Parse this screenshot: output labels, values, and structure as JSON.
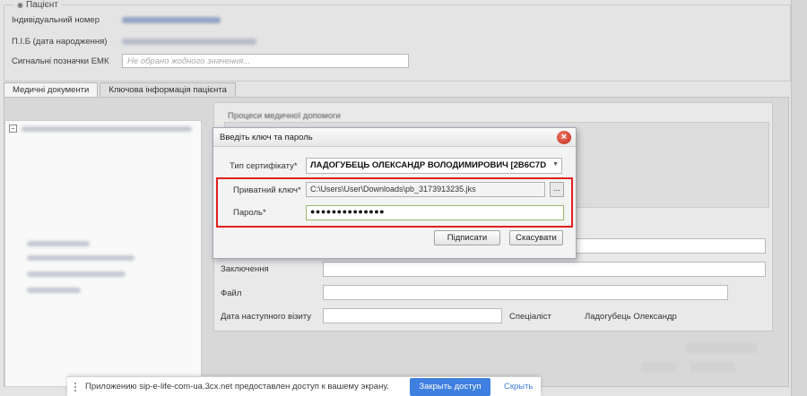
{
  "patient": {
    "legend": "Пацієнт",
    "fields": {
      "individual_number_label": "Індивідуальний номер",
      "full_name_label": "П.І.Б (дата народження)",
      "signal_marks_label": "Сигнальні позначки ЕМК",
      "signal_marks_placeholder": "Не обрано жодного значення..."
    }
  },
  "tabs": [
    {
      "label": "Медичні документи",
      "active": true
    },
    {
      "label": "Ключова інформація пацієнта",
      "active": false
    }
  ],
  "main": {
    "processes_label": "Процеси медичної допомоги",
    "conclusion_label": "Заключення",
    "file_label": "Файл",
    "next_visit_label": "Дата наступного візиту",
    "specialist_label": "Спеціаліст",
    "specialist_value": "Ладогубець Олександр"
  },
  "dialog": {
    "title": "Введіть ключ та пароль",
    "cert_type_label": "Тип сертифікату*",
    "cert_type_value": "ЛАДОГУБЕЦЬ ОЛЕКСАНДР ВОЛОДИМИРОВИЧ [2B6C7D",
    "private_key_label": "Приватний ключ*",
    "private_key_value": "C:\\Users\\User\\Downloads\\pb_3173913235.jks",
    "browse_label": "...",
    "password_label": "Пароль*",
    "password_value": "●●●●●●●●●●●●●●",
    "sign_button": "Підписати",
    "cancel_button": "Скасувати",
    "highlight_color": "#e02020"
  },
  "notification": {
    "text": "Приложению sip-e-life-com-ua.3cx.net предоставлен доступ к вашему экрану.",
    "stop_button": "Закрыть доступ",
    "hide_link": "Скрыть",
    "accent_color": "#3f7fe0"
  }
}
